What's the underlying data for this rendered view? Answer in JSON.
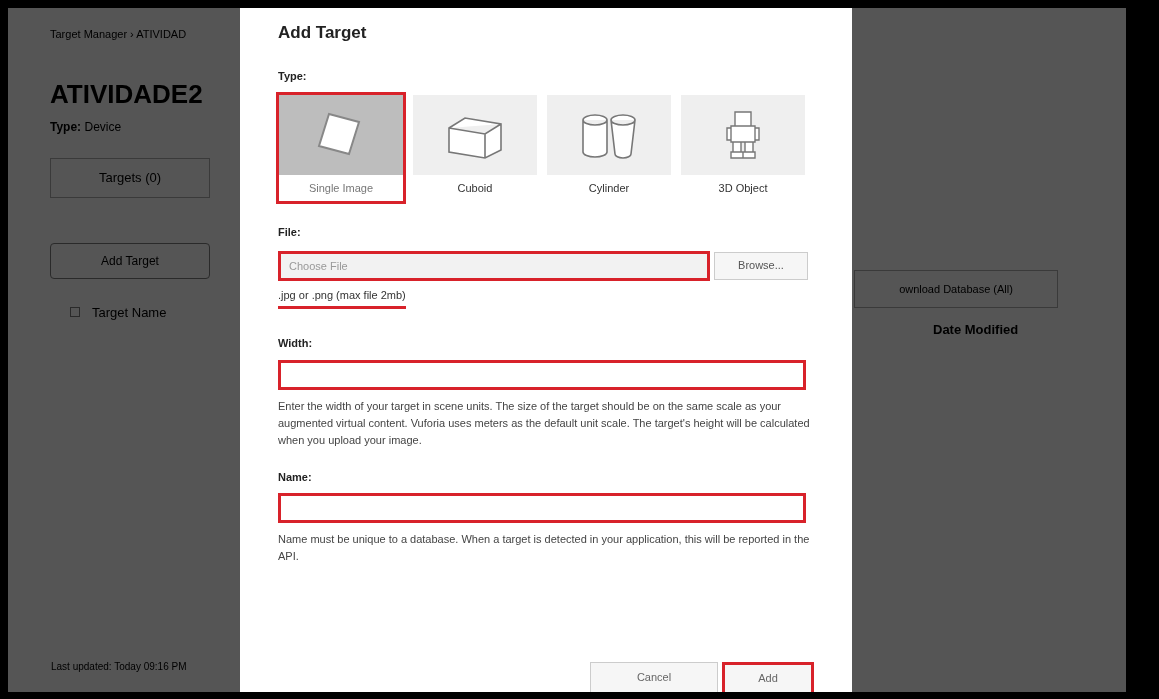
{
  "page": {
    "breadcrumb": "Target Manager › ATIVIDAD",
    "title": "ATIVIDADE2",
    "type_line": "**Type:** Device",
    "tabs": [
      {
        "label": "Targets (0)"
      }
    ],
    "select_all": {
      "checked": false
    },
    "add_button": "Add Target",
    "download_button": "ownload Database (All)",
    "columns": [
      "Target Name",
      "Date Modified"
    ],
    "footer": "Last updated: Today 09:16 PM"
  },
  "modal": {
    "title": "Add Target",
    "type_label": "Type:",
    "types": [
      {
        "label": "Single Image",
        "kind": "image",
        "selected": true,
        "highlighted": true
      },
      {
        "label": "Cuboid",
        "kind": "cuboid",
        "selected": false,
        "highlighted": false
      },
      {
        "label": "Cylinder",
        "kind": "cylinder",
        "selected": false,
        "highlighted": false
      },
      {
        "label": "3D Object",
        "kind": "object",
        "selected": false,
        "highlighted": false
      }
    ],
    "file": {
      "label": "File:",
      "placeholder": "Choose File",
      "browse": "Browse...",
      "hint": ".jpg or .png (max file 2mb)",
      "highlighted": true
    },
    "width": {
      "label": "Width:",
      "help": "Enter the width of your target in scene units. The size of the target should be on the same scale as your augmented virtual content. Vuforia uses meters as the default unit scale. The target's height will be calculated when you upload your image.",
      "highlighted": true
    },
    "name": {
      "label": "Name:",
      "help": "Name must be unique to a database. When a target is detected in your application, this will be reported in the API.",
      "highlighted": true
    },
    "buttons": [
      {
        "label": "Cancel",
        "kind": "cancel",
        "highlighted": false
      },
      {
        "label": "Add",
        "kind": "submit",
        "highlighted": true
      }
    ]
  }
}
